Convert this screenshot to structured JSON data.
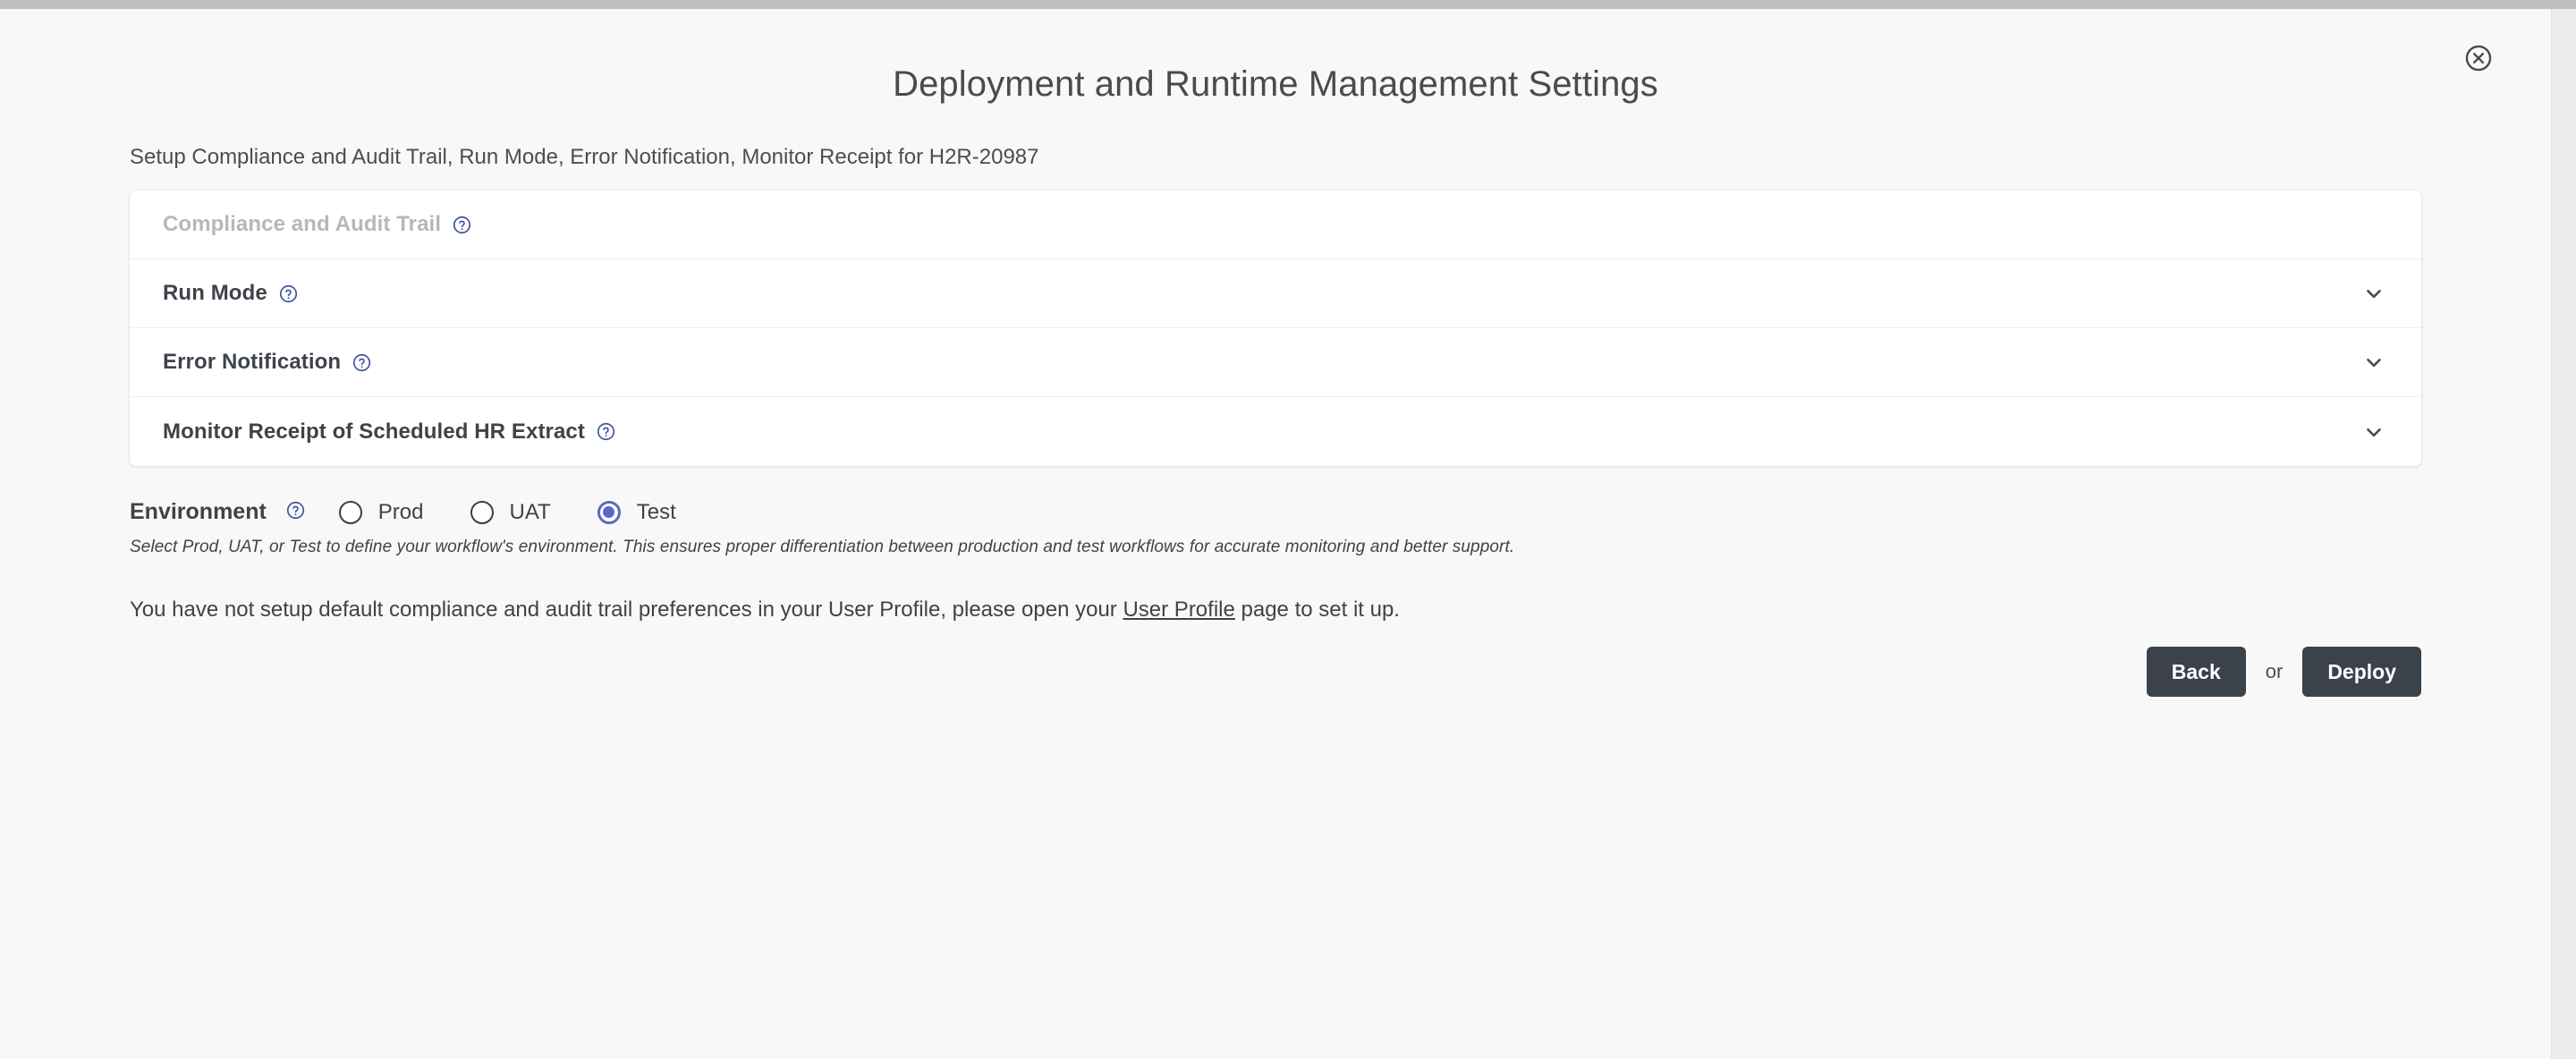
{
  "window": {
    "close_icon": "close-circle-icon"
  },
  "header": {
    "title": "Deployment and Runtime Management Settings",
    "subtitle": "Setup Compliance and Audit Trail, Run Mode, Error Notification, Monitor Receipt for H2R-20987"
  },
  "accordion": {
    "rows": [
      {
        "label": "Compliance and Audit Trail",
        "help_icon": "question-circle-icon",
        "disabled": true,
        "has_chevron": false
      },
      {
        "label": "Run Mode",
        "help_icon": "question-circle-icon",
        "disabled": false,
        "has_chevron": true,
        "chevron_icon": "chevron-down-icon"
      },
      {
        "label": "Error Notification",
        "help_icon": "question-circle-icon",
        "disabled": false,
        "has_chevron": true,
        "chevron_icon": "chevron-down-icon"
      },
      {
        "label": "Monitor Receipt of Scheduled HR Extract",
        "help_icon": "question-circle-icon",
        "disabled": false,
        "has_chevron": true,
        "chevron_icon": "chevron-down-icon"
      }
    ]
  },
  "environment": {
    "title": "Environment",
    "help_icon": "question-circle-icon",
    "options": [
      {
        "label": "Prod",
        "selected": false
      },
      {
        "label": "UAT",
        "selected": false
      },
      {
        "label": "Test",
        "selected": true
      }
    ],
    "hint": "Select Prod, UAT, or Test to define your workflow's environment. This ensures proper differentiation between production and test workflows for accurate monitoring and better support."
  },
  "notice": {
    "text_before": "You have not setup default compliance and audit trail preferences in your User Profile, please open your ",
    "link_text": "User Profile",
    "text_after": " page to set it up."
  },
  "actions": {
    "back_label": "Back",
    "separator_label": "or",
    "deploy_label": "Deploy"
  },
  "colors": {
    "page_background": "#f8f8f8",
    "card_background": "#ffffff",
    "accent_radio": "#5b69c4",
    "help_icon": "#3f51a0",
    "button_background": "#3c424c",
    "heading_text": "#3e434a",
    "disabled_text": "#b4b7bd"
  }
}
